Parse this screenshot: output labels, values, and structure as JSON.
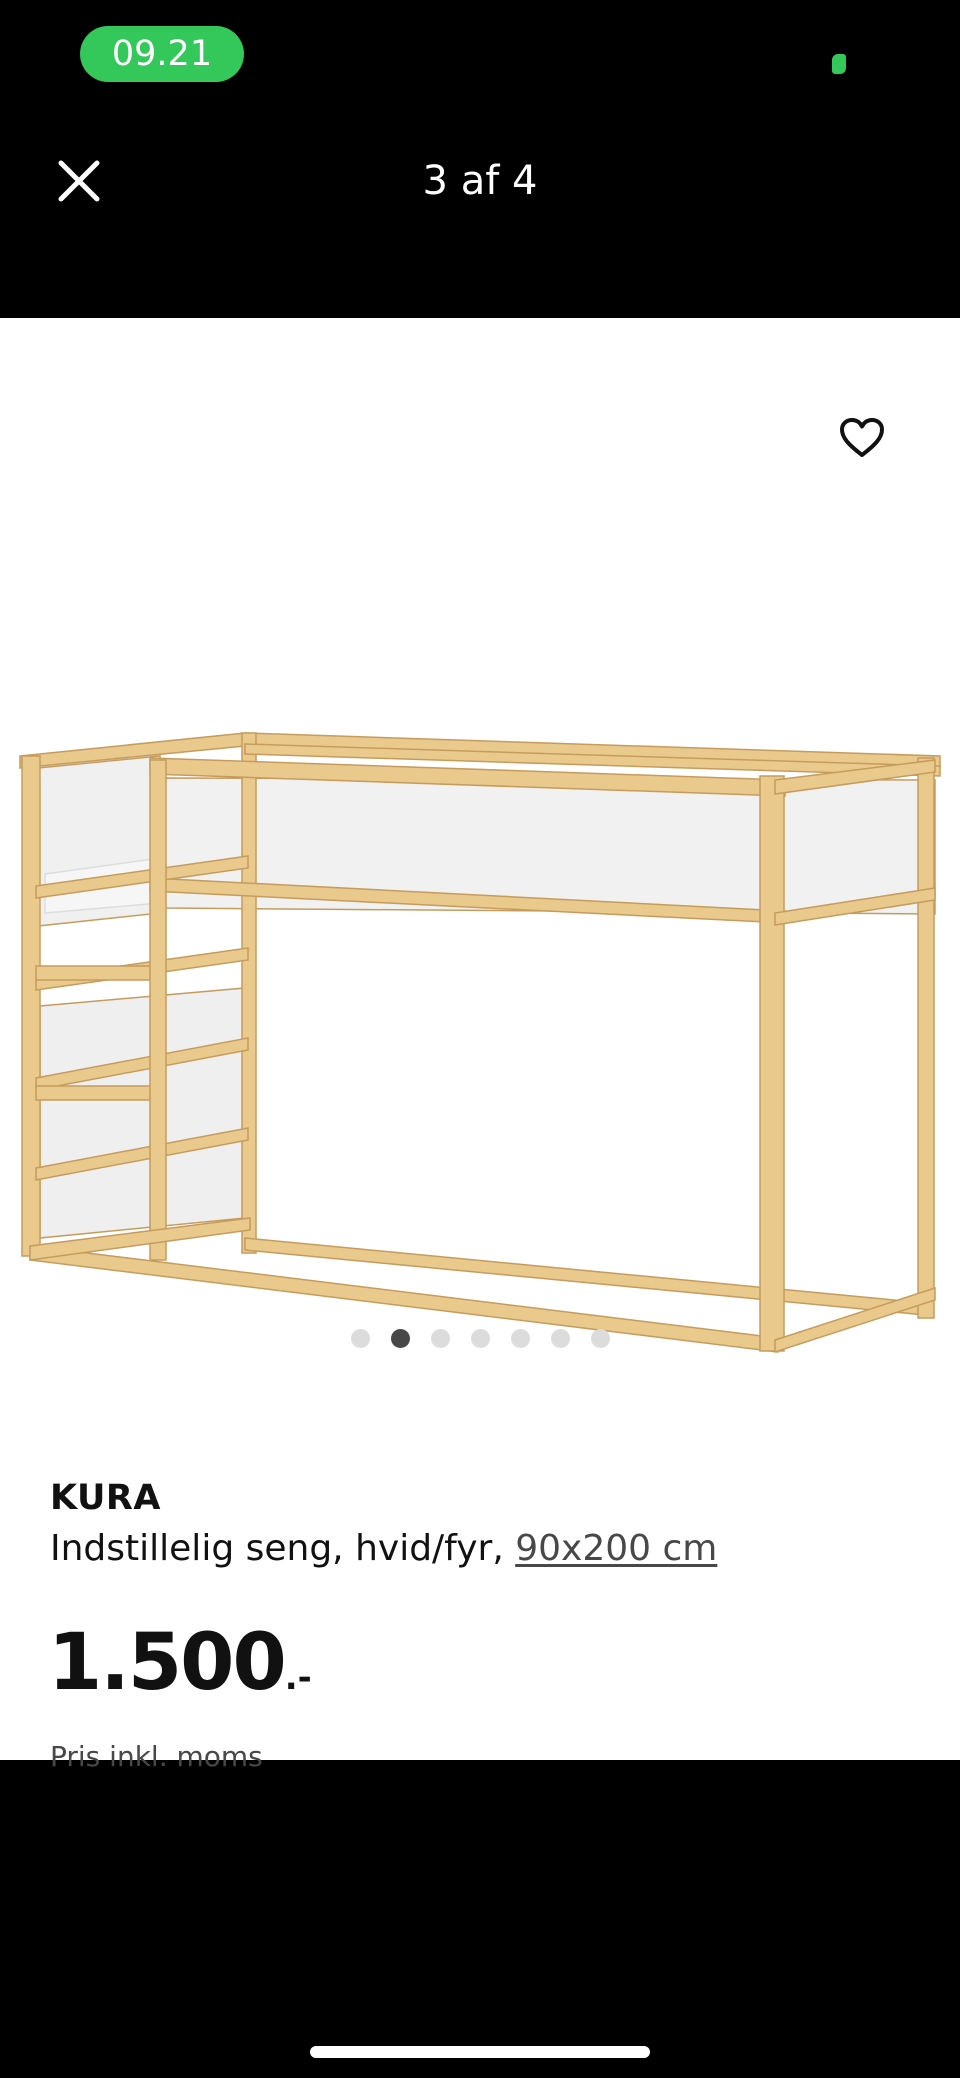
{
  "status_bar": {
    "time": "09.21"
  },
  "top_bar": {
    "counter": "3 af 4"
  },
  "icons": {
    "close": "close-icon",
    "favorite": "heart-icon",
    "status": "status-indicator-icon"
  },
  "gallery": {
    "dot_count": 7,
    "active_index": 1
  },
  "product": {
    "name": "KURA",
    "description": "Indstillelig seng, hvid/fyr, ",
    "size_link": "90x200 cm",
    "price": "1.500",
    "price_suffix": ".-",
    "price_note": "Pris inkl. moms"
  },
  "colors": {
    "accent": "#34c759",
    "background": "#000000",
    "sheet": "#ffffff",
    "wood": "#e9c98c",
    "panel": "#f2f2f2"
  }
}
